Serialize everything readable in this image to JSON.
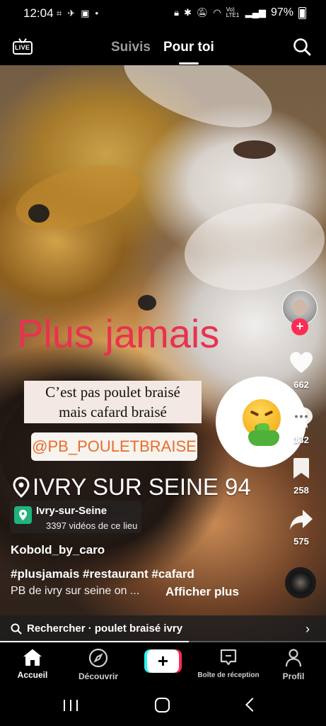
{
  "status_bar": {
    "time": "12:04",
    "battery": "97%",
    "network": "Vo) LTE1"
  },
  "top_nav": {
    "live_label": "LIVE",
    "tabs": [
      {
        "label": "Suivis",
        "active": false
      },
      {
        "label": "Pour toi",
        "active": true
      }
    ]
  },
  "video": {
    "overlay_title": "Plus jamais",
    "caption_line1": "C’est pas poulet braisé",
    "caption_line2": "mais cafard braisé",
    "handle_tag": "@PB_POULETBRAISE",
    "location_overlay": "IVRY SUR SEINE 94",
    "sticker": "nauseated-face-vomiting-emoji",
    "progress": 0.58
  },
  "place": {
    "name": "Ivry-sur-Seine",
    "count": "3397 vidéos de ce lieu"
  },
  "post": {
    "author": "Kobold_by_caro",
    "hashtags": "#plusjamais #restaurant #cafard",
    "description": "PB de ivry sur seine on ...",
    "more_label": "Afficher plus"
  },
  "actions": {
    "likes": "662",
    "comments": "132",
    "saves": "258",
    "shares": "575"
  },
  "search_bar": {
    "text": "Rechercher · poulet braisé ivry"
  },
  "bottom_nav": {
    "home": "Accueil",
    "discover": "Découvrir",
    "create": "+",
    "inbox": "Boîte de réception",
    "profile": "Profil"
  },
  "colors": {
    "accent_red": "#fe2c55",
    "accent_cyan": "#25f4ee",
    "overlay_red": "#e8324f",
    "handle_orange": "#e86d2a",
    "place_green": "#20b47a"
  }
}
